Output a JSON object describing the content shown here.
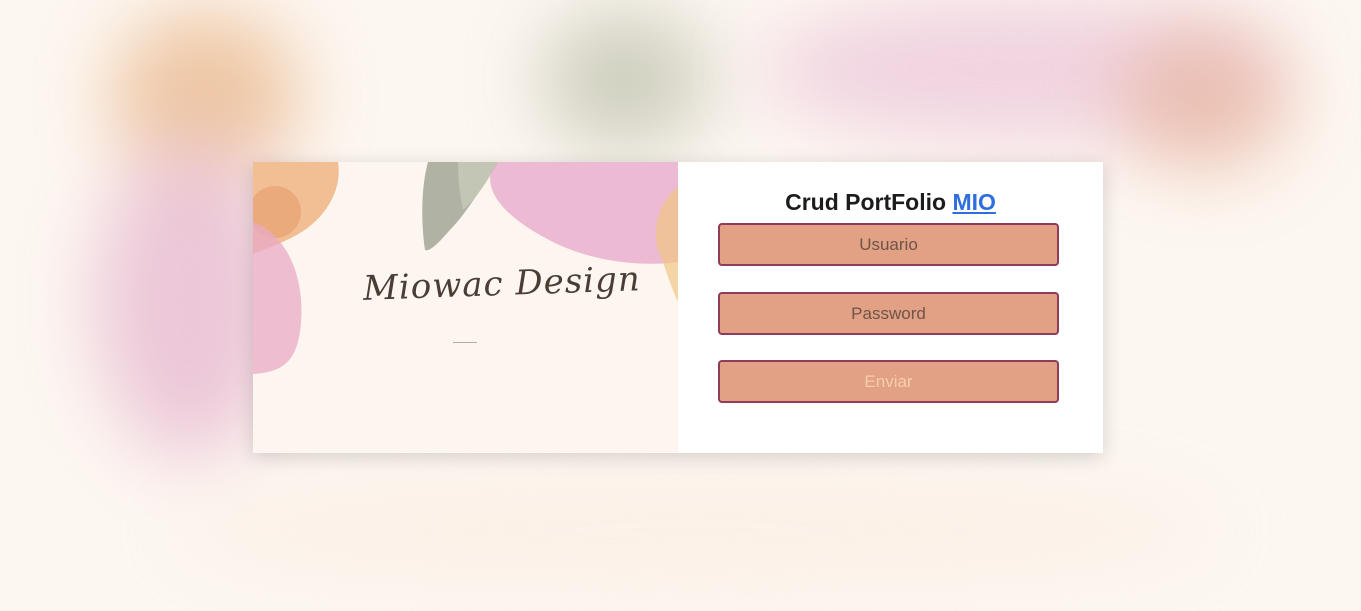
{
  "brand": {
    "name": "Miowac Design"
  },
  "login": {
    "title_prefix": "Crud PortFolio",
    "title_link": "MIO",
    "username_placeholder": "Usuario",
    "password_placeholder": "Password",
    "submit_label": "Enviar"
  },
  "colors": {
    "field_bg": "#e2a085",
    "field_border": "#8f3b5a",
    "link": "#2f6ee0"
  }
}
